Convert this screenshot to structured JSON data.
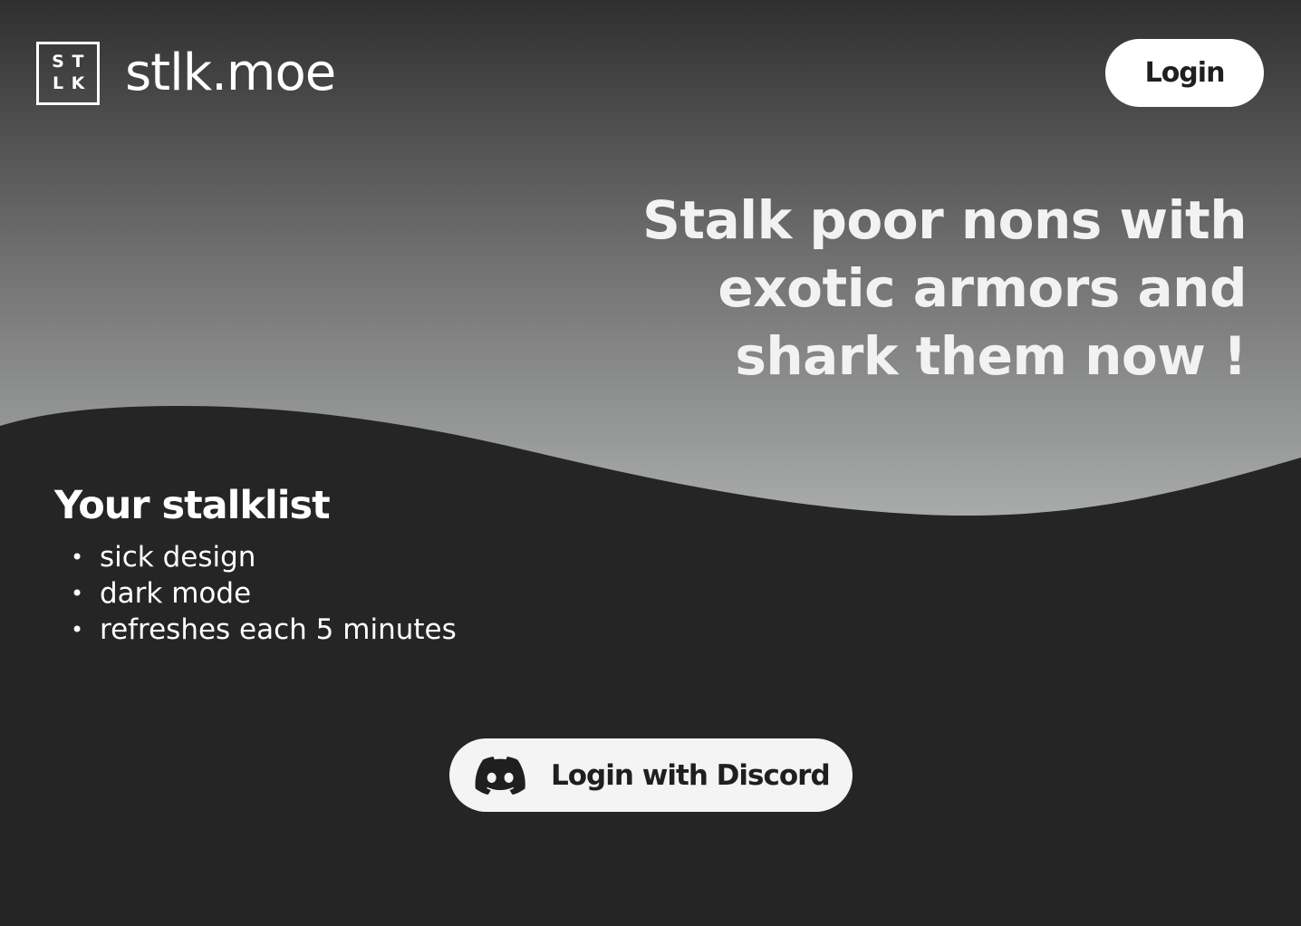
{
  "header": {
    "logo_letters": [
      "S",
      "T",
      "L",
      "K"
    ],
    "site_name": "stlk.moe",
    "login_label": "Login"
  },
  "hero": {
    "tagline_lines": [
      "Stalk poor nons with",
      "exotic armors and",
      "shark them now !"
    ]
  },
  "stalklist": {
    "title": "Your stalklist",
    "features": [
      "sick design",
      "dark mode",
      "refreshes each 5 minutes"
    ]
  },
  "discord": {
    "label": "Login with Discord",
    "icon": "discord-icon"
  },
  "colors": {
    "background": "#252525",
    "hero_gradient_top": "#2f2f2f",
    "hero_gradient_bottom": "#a9a9a9",
    "button_bg": "#f4f4f4",
    "button_text": "#1f1f1f"
  }
}
